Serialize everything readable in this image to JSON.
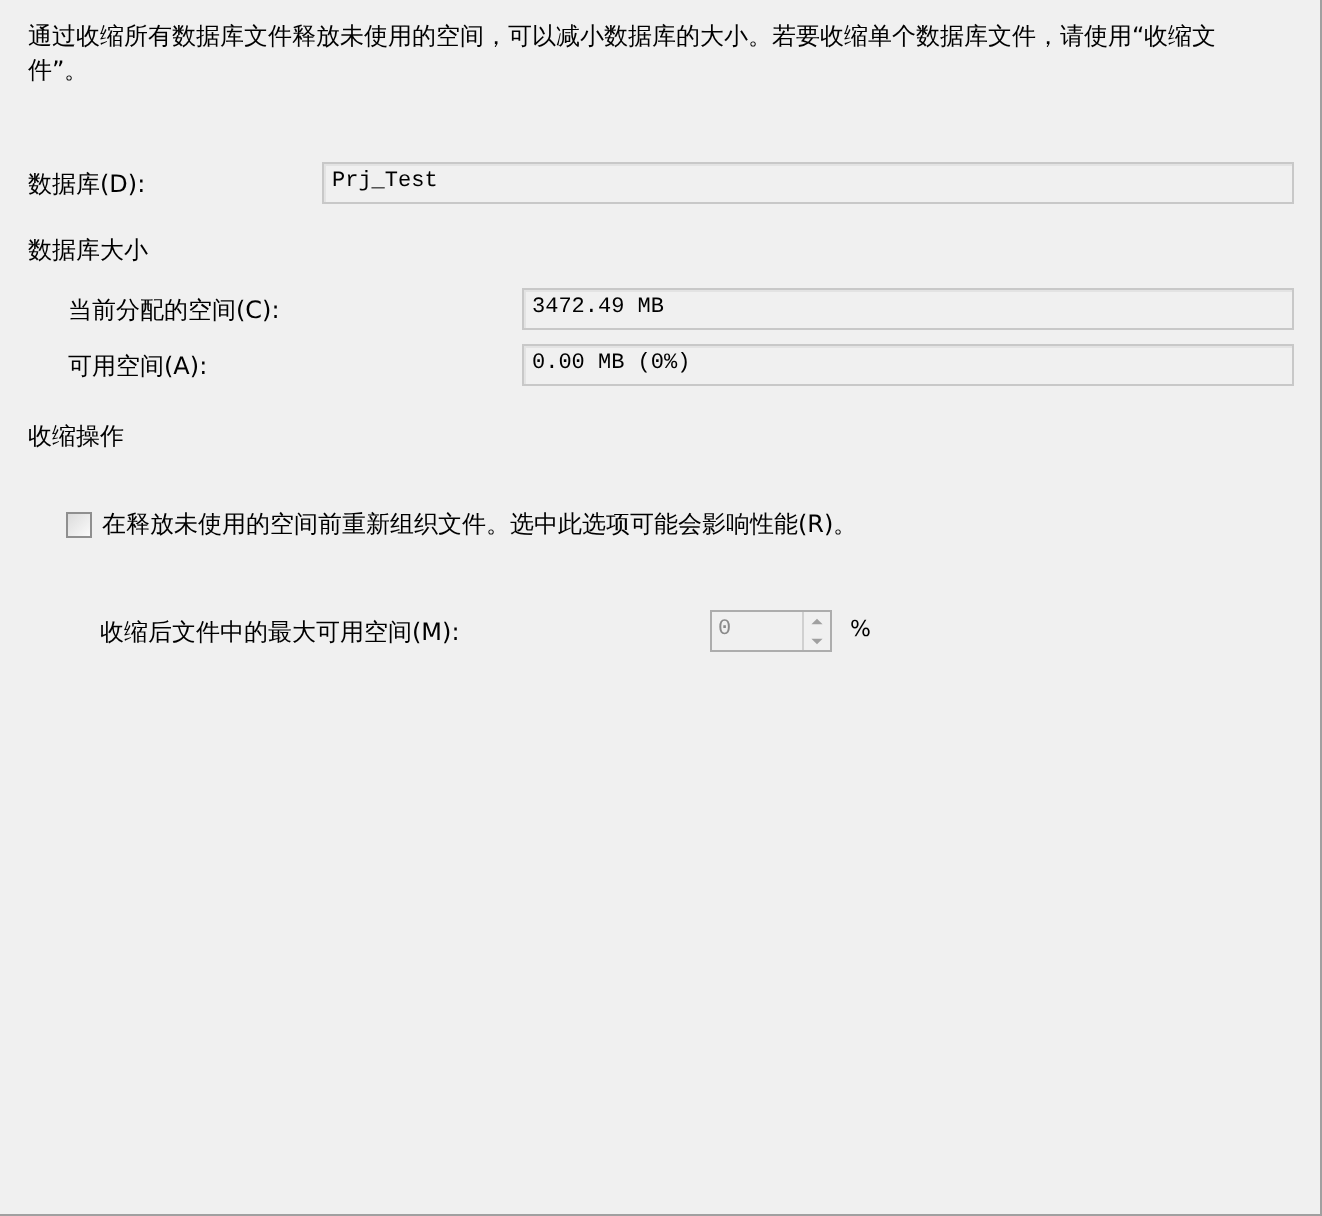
{
  "description": "通过收缩所有数据库文件释放未使用的空间，可以减小数据库的大小。若要收缩单个数据库文件，请使用“收缩文件”。",
  "database": {
    "label": "数据库(D):",
    "value": "Prj_Test"
  },
  "size_section": {
    "title": "数据库大小",
    "rows": [
      {
        "label": "当前分配的空间(C):",
        "value": "3472.49 MB"
      },
      {
        "label": "可用空间(A):",
        "value": "0.00 MB (0%)"
      }
    ]
  },
  "shrink_section": {
    "title": "收缩操作",
    "reorganize": {
      "label": "在释放未使用的空间前重新组织文件。选中此选项可能会影响性能(R)。",
      "checked": false
    },
    "max_free": {
      "label": "收缩后文件中的最大可用空间(M):",
      "value": "0",
      "disabled": true,
      "unit": "%"
    }
  }
}
